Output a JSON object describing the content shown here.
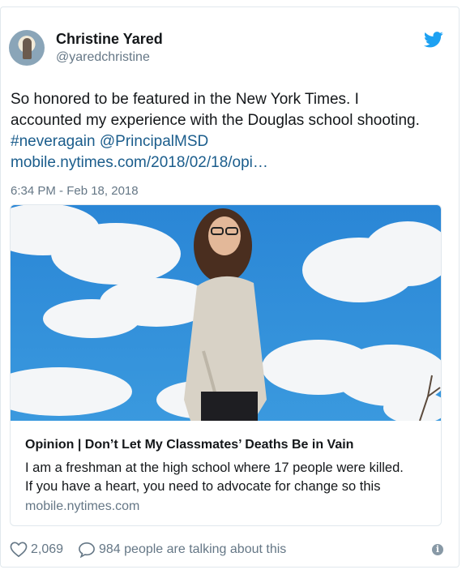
{
  "author": {
    "name": "Christine Yared",
    "handle": "@yaredchristine"
  },
  "tweet": {
    "text_line1": "So honored to be featured in the New York Times. I",
    "text_line2": "accounted my experience with the Douglas school shooting.",
    "hashtag": "#neveragain",
    "mention": "@PrincipalMSD",
    "link": "mobile.nytimes.com/2018/02/18/opi…",
    "timestamp": "6:34 PM - Feb 18, 2018"
  },
  "card": {
    "title": "Opinion | Don’t Let My Classmates’ Deaths Be in Vain",
    "desc_line1": "I am a freshman at the high school where 17 people were killed.",
    "desc_line2": "If you have a heart, you need to advocate for change so this",
    "domain": "mobile.nytimes.com"
  },
  "actions": {
    "likes": "2,069",
    "talking": "984 people are talking about this"
  },
  "icons": [
    "twitter-bird-icon",
    "heart-icon",
    "speech-bubble-icon",
    "info-icon"
  ],
  "colors": {
    "twitter_blue": "#1da1f2",
    "link": "#1b5d8c",
    "muted": "#657786",
    "sky": "#2f8fd8"
  }
}
